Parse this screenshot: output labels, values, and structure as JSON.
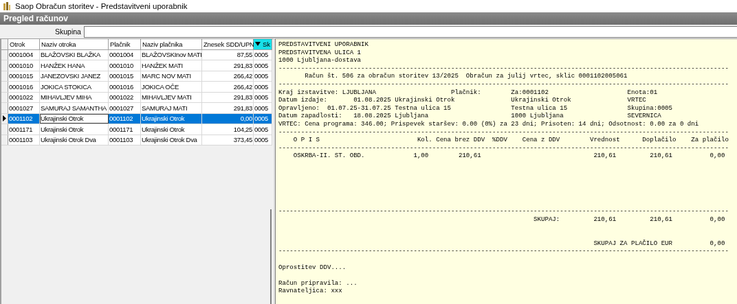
{
  "window": {
    "title": "Saop Obračun storitev - Predstavitveni uporabnik"
  },
  "panel": {
    "title": "Pregled računov"
  },
  "filter": {
    "label": "Skupina"
  },
  "table": {
    "columns": [
      {
        "label": "Otrok",
        "sorted": false
      },
      {
        "label": "Naziv otroka",
        "sorted": false
      },
      {
        "label": "Plačnik",
        "sorted": false
      },
      {
        "label": "Naziv plačnika",
        "sorted": false
      },
      {
        "label": "Znesek SDD/UPN",
        "sorted": false
      },
      {
        "label": "Sk",
        "sorted": true
      }
    ],
    "rows": [
      {
        "selected": false,
        "cells": [
          {
            "text": "0001004",
            "focused": false
          },
          {
            "text": "BLAŽOVSKI BLAŽKA",
            "focused": false
          },
          {
            "text": "0001004",
            "focused": false
          },
          {
            "text": "BLAŽOVSKInov MATI",
            "focused": false
          },
          {
            "text": "87,55",
            "focused": false
          },
          {
            "text": "0005",
            "focused": false
          }
        ]
      },
      {
        "selected": false,
        "cells": [
          {
            "text": "0001010",
            "focused": false
          },
          {
            "text": "HANŽEK HANA",
            "focused": false
          },
          {
            "text": "0001010",
            "focused": false
          },
          {
            "text": "HANŽEK MATI",
            "focused": false
          },
          {
            "text": "291,83",
            "focused": false
          },
          {
            "text": "0005",
            "focused": false
          }
        ]
      },
      {
        "selected": false,
        "cells": [
          {
            "text": "0001015",
            "focused": false
          },
          {
            "text": "JANEZOVSKI JANEZ",
            "focused": false
          },
          {
            "text": "0001015",
            "focused": false
          },
          {
            "text": "MARC NOV MATI",
            "focused": false
          },
          {
            "text": "266,42",
            "focused": false
          },
          {
            "text": "0005",
            "focused": false
          }
        ]
      },
      {
        "selected": false,
        "cells": [
          {
            "text": "0001016",
            "focused": false
          },
          {
            "text": "JOKICA STOKICA",
            "focused": false
          },
          {
            "text": "0001016",
            "focused": false
          },
          {
            "text": "JOKICA OČE",
            "focused": false
          },
          {
            "text": "266,42",
            "focused": false
          },
          {
            "text": "0005",
            "focused": false
          }
        ]
      },
      {
        "selected": false,
        "cells": [
          {
            "text": "0001022",
            "focused": false
          },
          {
            "text": "MIHAVLJEV MIHA",
            "focused": false
          },
          {
            "text": "0001022",
            "focused": false
          },
          {
            "text": "MIHAVLJEV MATI",
            "focused": false
          },
          {
            "text": "291,83",
            "focused": false
          },
          {
            "text": "0005",
            "focused": false
          }
        ]
      },
      {
        "selected": false,
        "cells": [
          {
            "text": "0001027",
            "focused": false
          },
          {
            "text": "SAMURAJ SAMANTHA",
            "focused": false
          },
          {
            "text": "0001027",
            "focused": false
          },
          {
            "text": "SAMURAJ MATI",
            "focused": false
          },
          {
            "text": "291,83",
            "focused": false
          },
          {
            "text": "0005",
            "focused": false
          }
        ]
      },
      {
        "selected": true,
        "cells": [
          {
            "text": "0001102",
            "focused": false
          },
          {
            "text": "Ukrajinski Otrok",
            "focused": true
          },
          {
            "text": "0001102",
            "focused": false
          },
          {
            "text": "Ukrajinski Otrok",
            "focused": false
          },
          {
            "text": "0,00",
            "focused": false
          },
          {
            "text": "0005",
            "focused": false
          }
        ]
      },
      {
        "selected": false,
        "cells": [
          {
            "text": "0001171",
            "focused": false
          },
          {
            "text": "Ukrajinski Otrok",
            "focused": false
          },
          {
            "text": "0001171",
            "focused": false
          },
          {
            "text": "Ukrajinski Otrok",
            "focused": false
          },
          {
            "text": "104,25",
            "focused": false
          },
          {
            "text": "0005",
            "focused": false
          }
        ]
      },
      {
        "selected": false,
        "cells": [
          {
            "text": "0001103",
            "focused": false
          },
          {
            "text": "Ukrajinski Otrok Dva",
            "focused": false
          },
          {
            "text": "0001103",
            "focused": false
          },
          {
            "text": "Ukrajinski Otrok Dva",
            "focused": false
          },
          {
            "text": "373,45",
            "focused": false
          },
          {
            "text": "0005",
            "focused": false
          }
        ]
      }
    ]
  },
  "report": {
    "lines": [
      {
        "kind": "text",
        "text": "PREDSTAVITVENI UPORABNIK"
      },
      {
        "kind": "text",
        "text": "PREDSTAVITVENA ULICA 1"
      },
      {
        "kind": "text",
        "text": "1000 Ljubljana-dostava"
      },
      {
        "kind": "rule",
        "text": "------------------------------------------------------------------------------------------------------------------------"
      },
      {
        "kind": "text",
        "text": "       Račun št. 506 za obračun storitev 13/2025  Obračun za julij vrtec, sklic 0001102005061"
      },
      {
        "kind": "rule",
        "text": "------------------------------------------------------------------------------------------------------------------------"
      },
      {
        "kind": "text",
        "text": "Kraj izstavitve: LJUBLJANA                    Plačnik:        Za:0001102                     Enota:01"
      },
      {
        "kind": "text",
        "text": "Datum izdaje:       01.08.2025 Ukrajinski Otrok               Ukrajinski Otrok               VRTEC"
      },
      {
        "kind": "text",
        "text": "Opravljeno:  01.07.25-31.07.25 Testna ulica 15                Testna ulica 15                Skupina:0005"
      },
      {
        "kind": "text",
        "text": "Datum zapadlosti:   18.08.2025 Ljubljana                      1000 Ljubljana                 SEVERNICA"
      },
      {
        "kind": "text",
        "text": "VRTEC: Cena programa: 346.00; Prispevek staršev: 0.00 (0%) za 23 dni; Prisoten: 14 dni; Odsotnost: 0.00 za 0 dni"
      },
      {
        "kind": "rule",
        "text": "------------------------------------------------------------------------------------------------------------------------"
      },
      {
        "kind": "text",
        "text": "    O P I S                          Kol. Cena brez DDV  %DDV    Cena z DDV        Vrednost      Doplačilo    Za plačilo"
      },
      {
        "kind": "rule",
        "text": "------------------------------------------------------------------------------------------------------------------------"
      },
      {
        "kind": "text",
        "text": "    OSKRBA-II. ST. OBD.             1,00        210,61                              210,61         210,61          0,00"
      },
      {
        "kind": "gap"
      },
      {
        "kind": "gap"
      },
      {
        "kind": "gap"
      },
      {
        "kind": "gap"
      },
      {
        "kind": "gap"
      },
      {
        "kind": "gap"
      },
      {
        "kind": "rule",
        "text": "------------------------------------------------------------------------------------------------------------------------"
      },
      {
        "kind": "text",
        "text": "                                                                    SKUPAJ:         210,61         210,61          0,00"
      },
      {
        "kind": "gap"
      },
      {
        "kind": "gap"
      },
      {
        "kind": "text",
        "text": "                                                                                    SKUPAJ ZA PLAČILO EUR          0,00"
      },
      {
        "kind": "rule",
        "text": "------------------------------------------------------------------------------------------------------------------------"
      },
      {
        "kind": "gap"
      },
      {
        "kind": "text",
        "text": "Oprostitev DDV...."
      },
      {
        "kind": "gap"
      },
      {
        "kind": "text",
        "text": "Račun pripravila: ..."
      },
      {
        "kind": "text",
        "text": "Ravnateljica: xxx"
      }
    ]
  }
}
